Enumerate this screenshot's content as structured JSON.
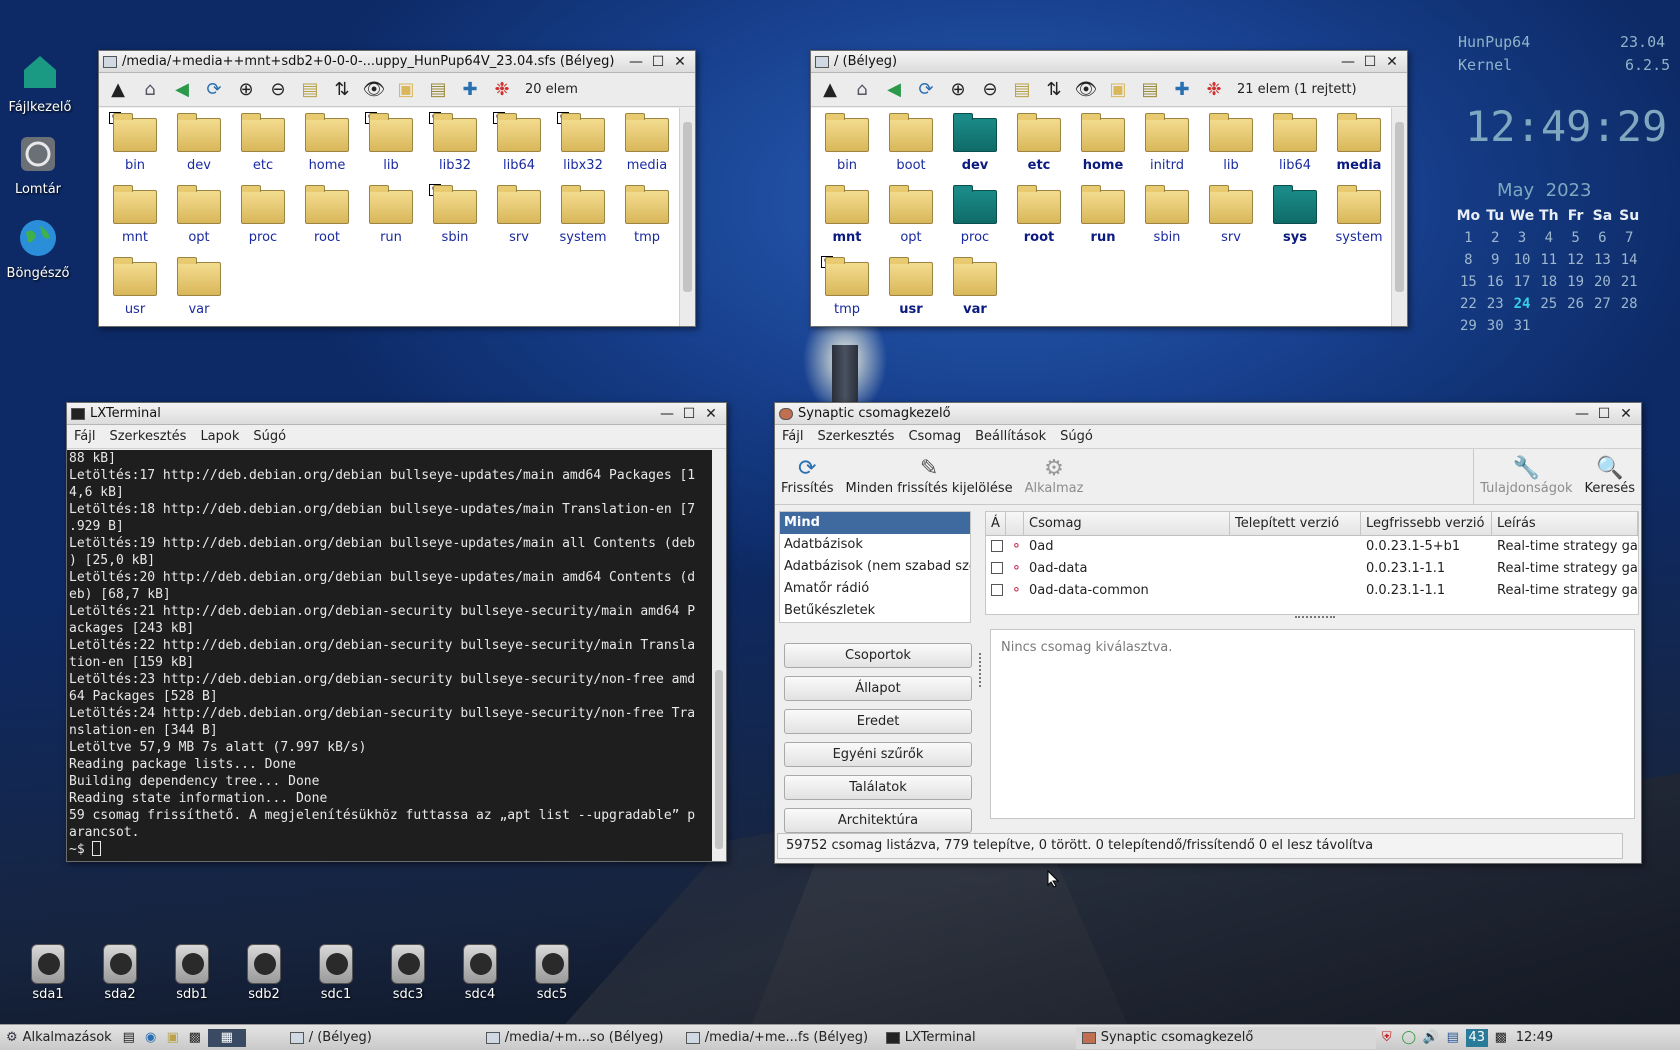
{
  "desktop": {
    "icons": [
      {
        "label": "Fájlkezelő"
      },
      {
        "label": "Lomtár"
      },
      {
        "label": "Böngésző"
      }
    ],
    "drives": [
      "sda1",
      "sda2",
      "sdb1",
      "sdb2",
      "sdc1",
      "sdc3",
      "sdc4",
      "sdc5"
    ]
  },
  "fm1": {
    "title": "/media/+media++mnt+sdb2+0-0-0-...uppy_HunPup64V_23.04.sfs (Bélyeg)",
    "count": "20 elem",
    "folders": [
      "bin",
      "dev",
      "etc",
      "home",
      "lib",
      "lib32",
      "lib64",
      "libx32",
      "media",
      "mnt",
      "opt",
      "proc",
      "root",
      "run",
      "sbin",
      "srv",
      "system",
      "tmp",
      "usr",
      "var"
    ]
  },
  "fm2": {
    "title": "/ (Bélyeg)",
    "count": "21 elem (1 rejtett)",
    "folders": [
      "bin",
      "boot",
      "dev",
      "etc",
      "home",
      "initrd",
      "lib",
      "lib64",
      "media",
      "mnt",
      "opt",
      "proc",
      "root",
      "run",
      "sbin",
      "srv",
      "sys",
      "system",
      "tmp",
      "usr",
      "var"
    ]
  },
  "terminal": {
    "title": "LXTerminal",
    "menu": [
      "Fájl",
      "Szerkesztés",
      "Lapok",
      "Súgó"
    ],
    "lines": [
      "88 kB]",
      "Letöltés:17 http://deb.debian.org/debian bullseye-updates/main amd64 Packages [1",
      "4,6 kB]",
      "Letöltés:18 http://deb.debian.org/debian bullseye-updates/main Translation-en [7",
      ".929 B]",
      "Letöltés:19 http://deb.debian.org/debian bullseye-updates/main all Contents (deb",
      ") [25,0 kB]",
      "Letöltés:20 http://deb.debian.org/debian bullseye-updates/main amd64 Contents (d",
      "eb) [68,7 kB]",
      "Letöltés:21 http://deb.debian.org/debian-security bullseye-security/main amd64 P",
      "ackages [243 kB]",
      "Letöltés:22 http://deb.debian.org/debian-security bullseye-security/main Transla",
      "tion-en [159 kB]",
      "Letöltés:23 http://deb.debian.org/debian-security bullseye-security/non-free amd",
      "64 Packages [528 B]",
      "Letöltés:24 http://deb.debian.org/debian-security bullseye-security/non-free Tra",
      "nslation-en [344 B]",
      "Letöltve 57,9 MB 7s alatt (7.997 kB/s)",
      "Reading package lists... Done",
      "Building dependency tree... Done",
      "Reading state information... Done",
      "59 csomag frissíthető. A megjelenítésükhöz futtassa az „apt list --upgradable” p",
      "arancsot."
    ],
    "prompt": "~$ "
  },
  "synaptic": {
    "title": "Synaptic csomagkezelő",
    "menu": [
      "Fájl",
      "Szerkesztés",
      "Csomag",
      "Beállítások",
      "Súgó"
    ],
    "toolbar": {
      "refresh": "Frissítés",
      "mark_all": "Minden frissítés kijelölése",
      "apply": "Alkalmaz",
      "properties": "Tulajdonságok",
      "search": "Keresés"
    },
    "categories": [
      "Mind",
      "Adatbázisok",
      "Adatbázisok (nem szabad szo",
      "Amatőr rádió",
      "Betűkészletek"
    ],
    "filters": [
      "Csoportok",
      "Állapot",
      "Eredet",
      "Egyéni szűrők",
      "Találatok",
      "Architektúra"
    ],
    "columns": {
      "status": "Á",
      "package": "Csomag",
      "installed": "Telepített verzió",
      "latest": "Legfrissebb verzió",
      "description": "Leírás"
    },
    "packages": [
      {
        "name": "0ad",
        "installed": "",
        "latest": "0.0.23.1-5+b1",
        "description": "Real-time strategy gam"
      },
      {
        "name": "0ad-data",
        "installed": "",
        "latest": "0.0.23.1-1.1",
        "description": "Real-time strategy gam"
      },
      {
        "name": "0ad-data-common",
        "installed": "",
        "latest": "0.0.23.1-1.1",
        "description": "Real-time strategy gam"
      }
    ],
    "detail": "Nincs csomag kiválasztva.",
    "status": "59752 csomag listázva, 779 telepítve, 0 törött. 0 telepítendő/frissítendő 0 el lesz távolítva"
  },
  "conky": {
    "distro": "HunPup64",
    "distro_version": "23.04",
    "kernel_label": "Kernel",
    "kernel_version": "6.2.5",
    "time": "12:49:29",
    "month": "May  2023",
    "weekdays": [
      "Mo",
      "Tu",
      "We",
      "Th",
      "Fr",
      "Sa",
      "Su"
    ],
    "weeks": [
      [
        "1",
        "2",
        "3",
        "4",
        "5",
        "6",
        "7"
      ],
      [
        "8",
        "9",
        "10",
        "11",
        "12",
        "13",
        "14"
      ],
      [
        "15",
        "16",
        "17",
        "18",
        "19",
        "20",
        "21"
      ],
      [
        "22",
        "23",
        "24",
        "25",
        "26",
        "27",
        "28"
      ],
      [
        "29",
        "30",
        "31",
        "",
        "",
        "",
        ""
      ]
    ],
    "today": "24"
  },
  "taskbar": {
    "menu": "Alkalmazások",
    "tasks": [
      "/ (Bélyeg)",
      "/media/+m...so (Bélyeg)",
      "/media/+me...fs (Bélyeg)",
      "LXTerminal",
      "Synaptic csomagkezelő"
    ],
    "tray_temp": "43",
    "clock": "12:49"
  },
  "colors": {
    "accent": "#3f6aa0",
    "terminal_bg": "#1e1e1e",
    "folder_link": "#1a2aa0",
    "special_folder": "#0f6b68"
  }
}
